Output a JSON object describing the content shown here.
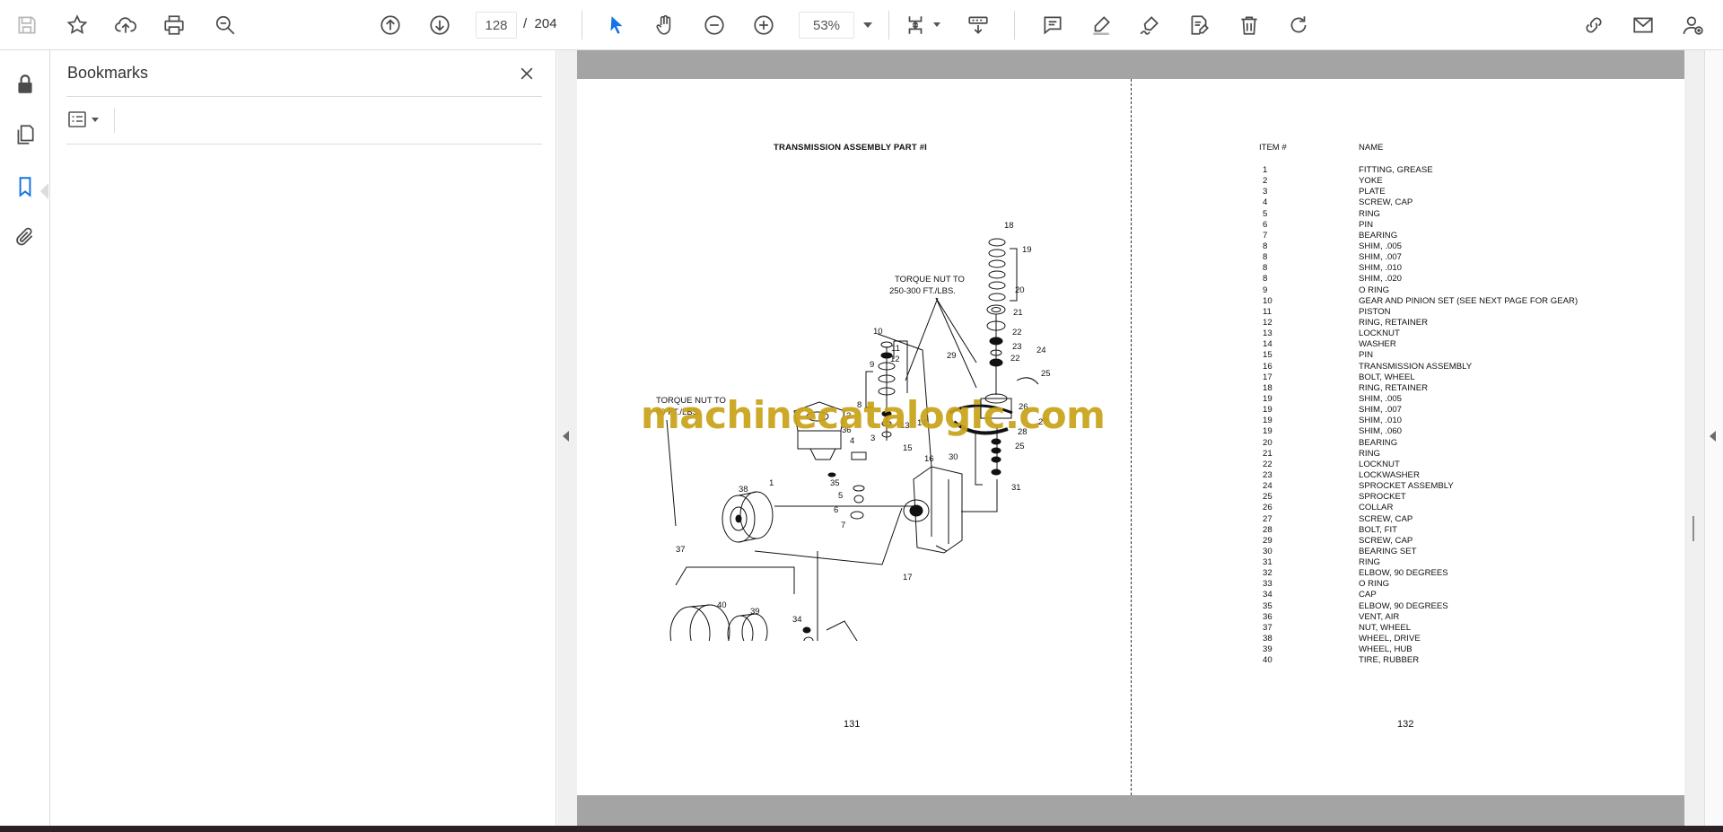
{
  "toolbar": {
    "current_page": "128",
    "page_separator": "/",
    "total_pages": "204",
    "zoom": "53%"
  },
  "bookmarks": {
    "title": "Bookmarks"
  },
  "document": {
    "left_page": {
      "title": "TRANSMISSION ASSEMBLY PART #I",
      "page_number": "131",
      "watermark": "machinecatalogic.com",
      "callouts": {
        "torque_a": [
          "TORQUE NUT TO",
          "90 FT./LBS."
        ],
        "torque_b": [
          "TORQUE NUT TO",
          "250-300 FT./LBS."
        ]
      }
    },
    "right_page": {
      "col_item": "ITEM #",
      "col_name": "NAME",
      "page_number": "132",
      "parts": [
        {
          "item": "1",
          "name": "FITTING, GREASE"
        },
        {
          "item": "2",
          "name": "YOKE"
        },
        {
          "item": "3",
          "name": "PLATE"
        },
        {
          "item": "4",
          "name": "SCREW, CAP"
        },
        {
          "item": "5",
          "name": "RING"
        },
        {
          "item": "6",
          "name": "PIN"
        },
        {
          "item": "7",
          "name": "BEARING"
        },
        {
          "item": "8",
          "name": "SHIM, .005"
        },
        {
          "item": "8",
          "name": "SHIM, .007"
        },
        {
          "item": "8",
          "name": "SHIM, .010"
        },
        {
          "item": "8",
          "name": "SHIM, .020"
        },
        {
          "item": "9",
          "name": "O RING"
        },
        {
          "item": "10",
          "name": "GEAR AND PINION SET (SEE NEXT PAGE FOR GEAR)"
        },
        {
          "item": "11",
          "name": "PISTON"
        },
        {
          "item": "12",
          "name": "RING, RETAINER"
        },
        {
          "item": "13",
          "name": "LOCKNUT"
        },
        {
          "item": "14",
          "name": "WASHER"
        },
        {
          "item": "15",
          "name": "PIN"
        },
        {
          "item": "16",
          "name": "TRANSMISSION ASSEMBLY"
        },
        {
          "item": "17",
          "name": "BOLT, WHEEL"
        },
        {
          "item": "18",
          "name": "RING, RETAINER"
        },
        {
          "item": "19",
          "name": "SHIM, .005"
        },
        {
          "item": "19",
          "name": "SHIM, .007"
        },
        {
          "item": "19",
          "name": "SHIM, .010"
        },
        {
          "item": "19",
          "name": "SHIM, .060"
        },
        {
          "item": "20",
          "name": "BEARING"
        },
        {
          "item": "21",
          "name": "RING"
        },
        {
          "item": "22",
          "name": "LOCKNUT"
        },
        {
          "item": "23",
          "name": "LOCKWASHER"
        },
        {
          "item": "24",
          "name": "SPROCKET ASSEMBLY"
        },
        {
          "item": "25",
          "name": "SPROCKET"
        },
        {
          "item": "26",
          "name": "COLLAR"
        },
        {
          "item": "27",
          "name": "SCREW, CAP"
        },
        {
          "item": "28",
          "name": "BOLT, FIT"
        },
        {
          "item": "29",
          "name": "SCREW, CAP"
        },
        {
          "item": "30",
          "name": "BEARING SET"
        },
        {
          "item": "31",
          "name": "RING"
        },
        {
          "item": "32",
          "name": "ELBOW, 90 DEGREES"
        },
        {
          "item": "33",
          "name": "O RING"
        },
        {
          "item": "34",
          "name": "CAP"
        },
        {
          "item": "35",
          "name": "ELBOW, 90 DEGREES"
        },
        {
          "item": "36",
          "name": "VENT, AIR"
        },
        {
          "item": "37",
          "name": "NUT, WHEEL"
        },
        {
          "item": "38",
          "name": "WHEEL, DRIVE"
        },
        {
          "item": "39",
          "name": "WHEEL, HUB"
        },
        {
          "item": "40",
          "name": "TIRE, RUBBER"
        }
      ]
    }
  },
  "colors": {
    "accent": "#1473e6",
    "watermark": "#c9a319"
  },
  "icons": [
    "save-icon",
    "star-icon",
    "upload-icon",
    "print-icon",
    "zoom-search-icon",
    "page-up-icon",
    "page-down-icon",
    "select-arrow-icon",
    "hand-icon",
    "zoom-out-icon",
    "zoom-in-icon",
    "fit-page-icon",
    "scroll-mode-icon",
    "comment-icon",
    "highlight-icon",
    "sign-icon",
    "fill-sign-icon",
    "delete-icon",
    "rotate-icon",
    "share-link-icon",
    "email-icon",
    "account-icon",
    "lock-icon",
    "pages-icon",
    "bookmark-icon",
    "attachment-icon",
    "close-icon",
    "options-icon"
  ]
}
